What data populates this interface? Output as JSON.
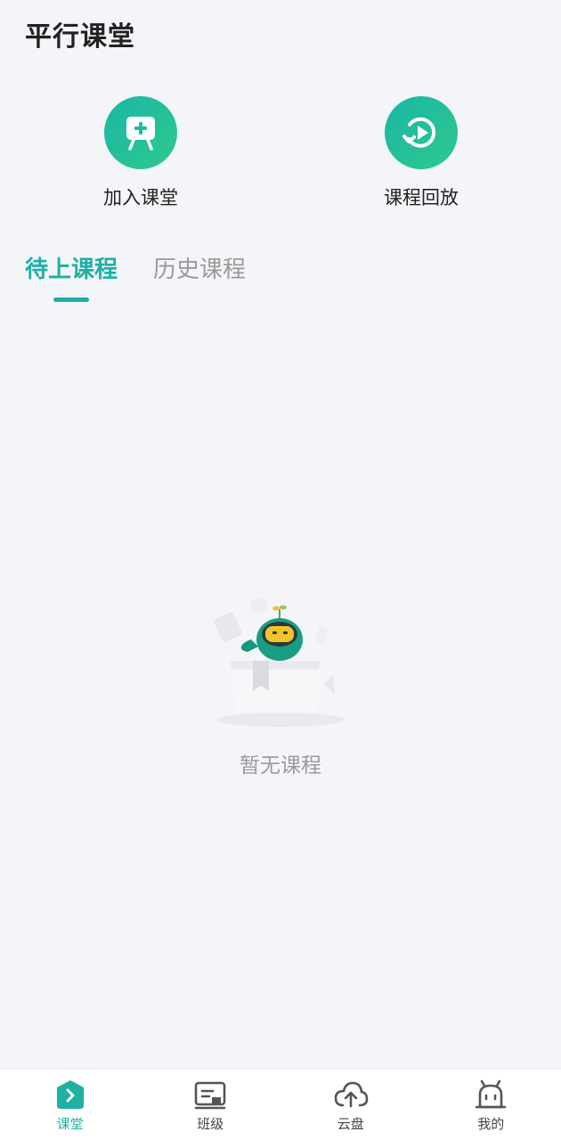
{
  "header": {
    "title": "平行课堂"
  },
  "actions": [
    {
      "label": "加入课堂",
      "icon": "easel-plus-icon"
    },
    {
      "label": "课程回放",
      "icon": "replay-icon"
    }
  ],
  "tabs": [
    {
      "label": "待上课程",
      "active": true
    },
    {
      "label": "历史课程",
      "active": false
    }
  ],
  "empty_state": {
    "text": "暂无课程",
    "illustration": "robot-in-box-illustration"
  },
  "bottom_nav": [
    {
      "label": "课堂",
      "icon": "classroom-icon",
      "active": true
    },
    {
      "label": "班级",
      "icon": "class-icon",
      "active": false
    },
    {
      "label": "云盘",
      "icon": "cloud-upload-icon",
      "active": false
    },
    {
      "label": "我的",
      "icon": "robot-face-icon",
      "active": false
    }
  ],
  "colors": {
    "accent": "#1db0a3",
    "background": "#f4f5f9"
  }
}
